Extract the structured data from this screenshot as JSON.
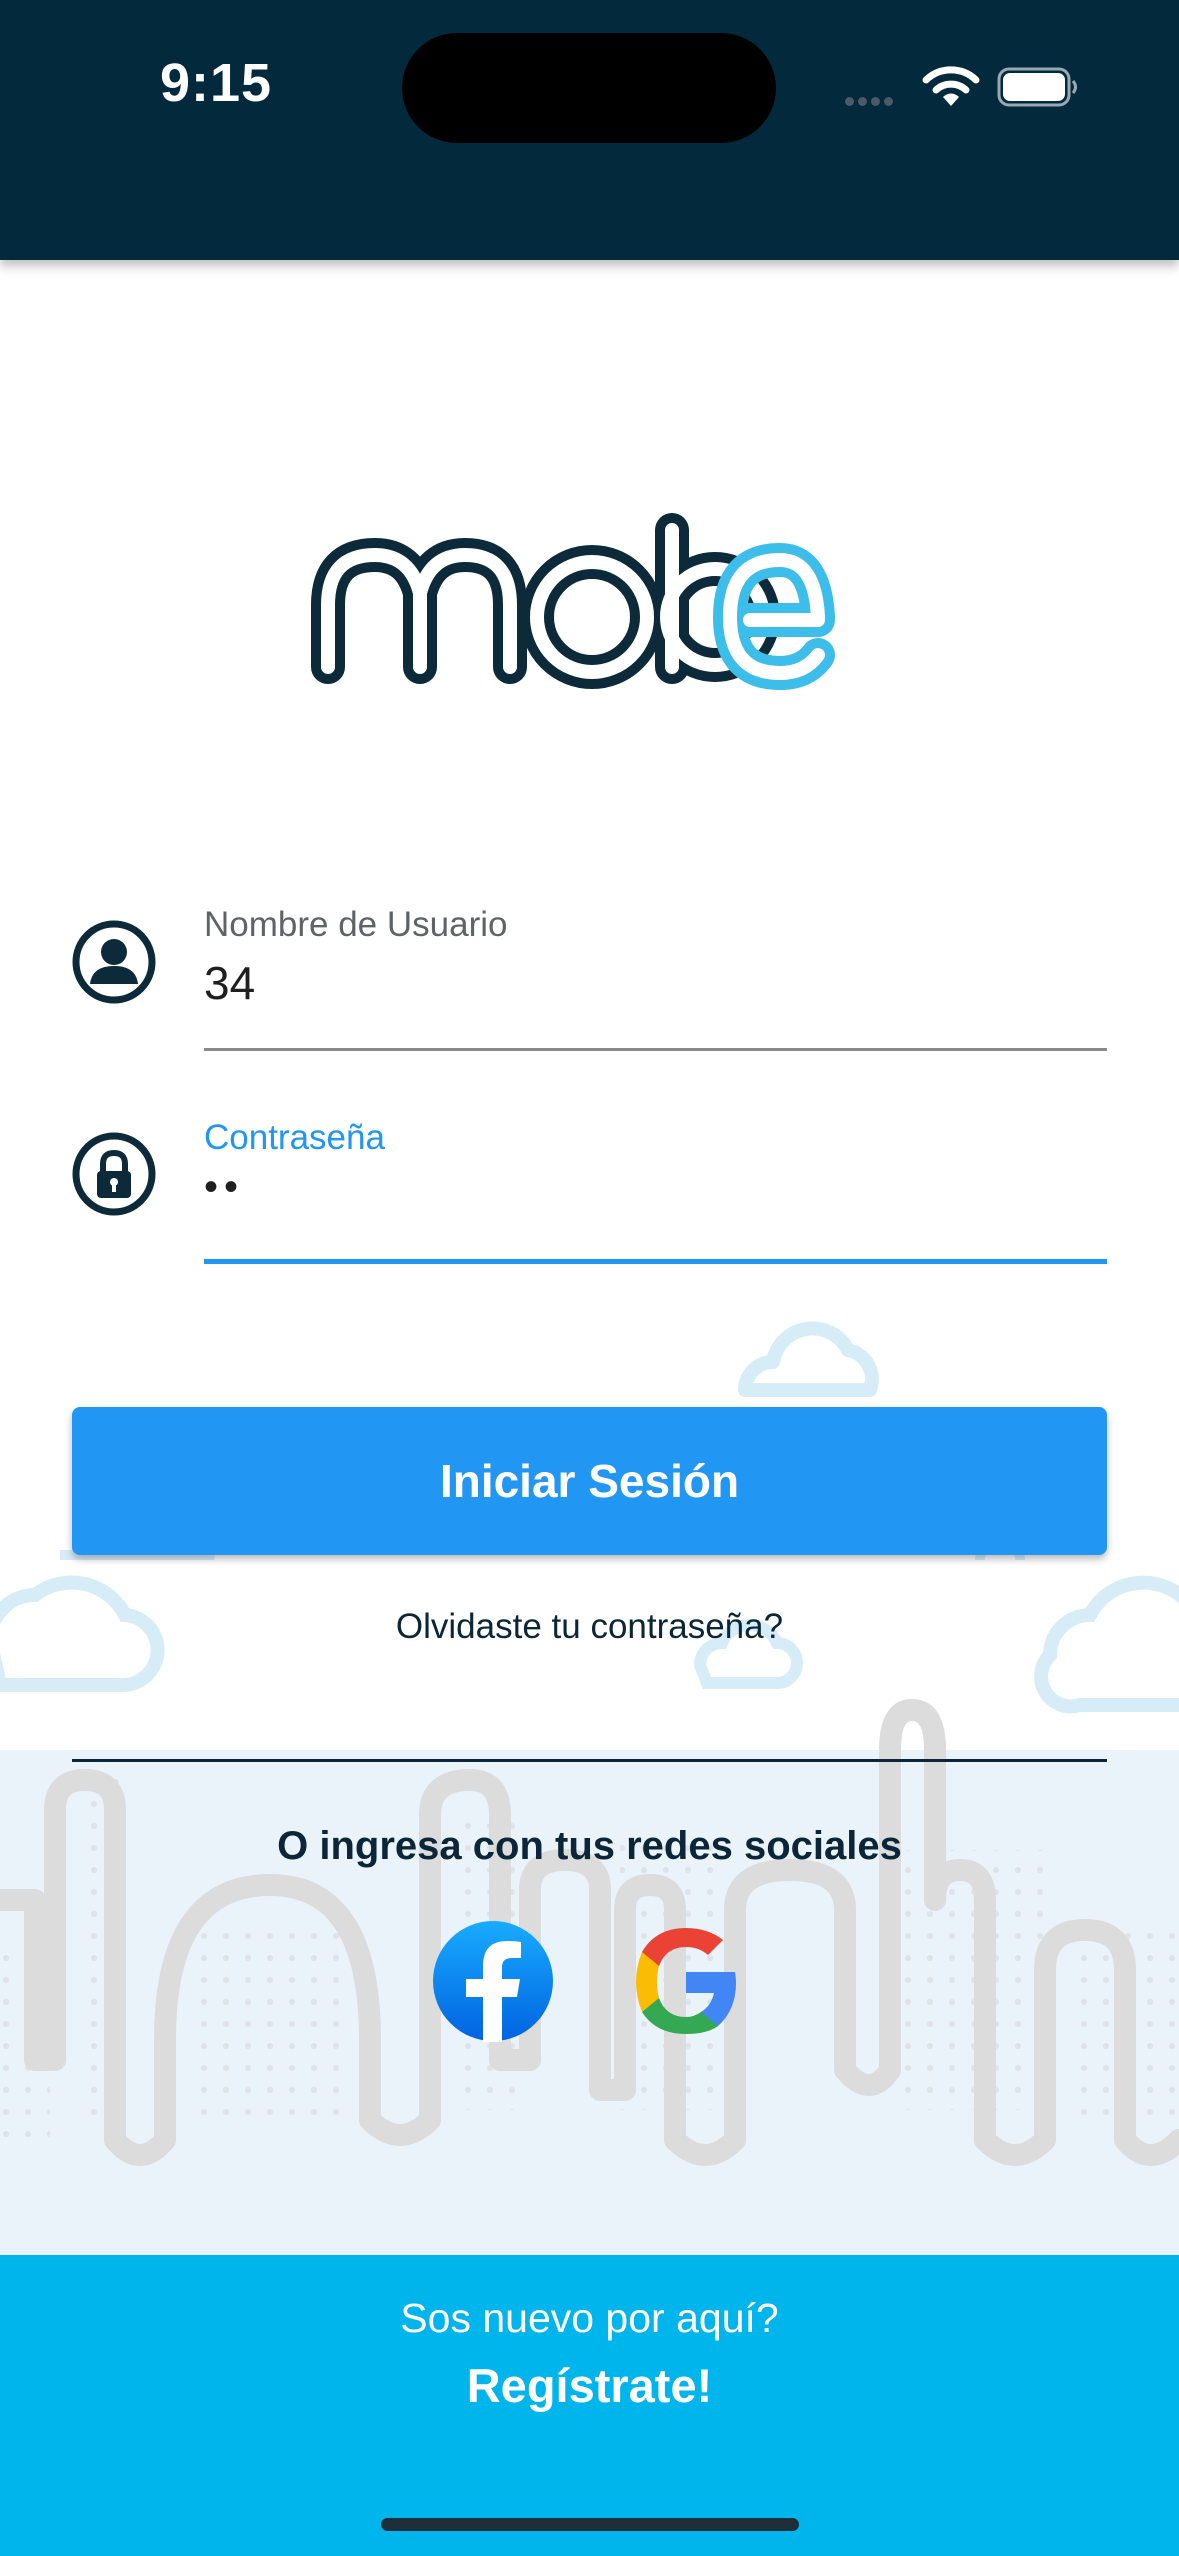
{
  "status_bar": {
    "time": "9:15"
  },
  "logo": {
    "text": "mobe"
  },
  "username": {
    "label": "Nombre de Usuario",
    "value": "34"
  },
  "password": {
    "label": "Contraseña",
    "value": "••"
  },
  "login_button": {
    "label": "Iniciar Sesión"
  },
  "forgot_password": {
    "label": "Olvidaste tu contraseña?"
  },
  "social": {
    "heading": "O ingresa con tus redes sociales",
    "providers": [
      "facebook-icon",
      "google-icon"
    ]
  },
  "footer": {
    "question": "Sos nuevo por aquí?",
    "register": "Regístrate!"
  },
  "colors": {
    "status_bar": "#03293c",
    "primary": "#2196f3",
    "footer": "#00b4ec",
    "dark_text": "#0b2638",
    "logo_accent": "#3dbdea"
  }
}
